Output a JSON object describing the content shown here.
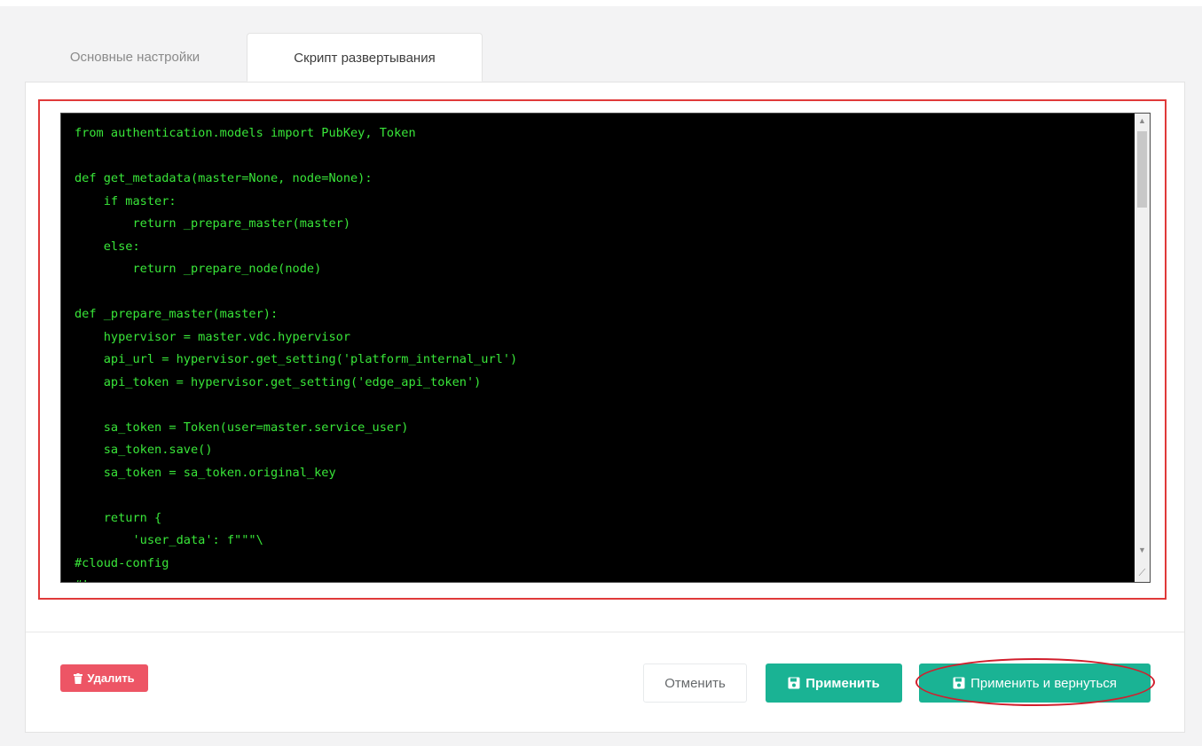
{
  "tabs": [
    {
      "label": "Основные настройки",
      "active": false
    },
    {
      "label": "Скрипт развертывания",
      "active": true
    }
  ],
  "editor": {
    "code": "from authentication.models import PubKey, Token\n\ndef get_metadata(master=None, node=None):\n    if master:\n        return _prepare_master(master)\n    else:\n        return _prepare_node(node)\n\ndef _prepare_master(master):\n    hypervisor = master.vdc.hypervisor\n    api_url = hypervisor.get_setting('platform_internal_url')\n    api_token = hypervisor.get_setting('edge_api_token')\n\n    sa_token = Token(user=master.service_user)\n    sa_token.save()\n    sa_token = sa_token.original_key\n\n    return {\n        'user_data': f\"\"\"\\\n#cloud-config\n#!"
  },
  "buttons": {
    "delete_label": "Удалить",
    "cancel_label": "Отменить",
    "apply_label": "Применить",
    "apply_return_label": "Применить и вернуться"
  },
  "colors": {
    "accent": "#1ab394",
    "danger": "#ed5565",
    "code_text": "#39e639",
    "code_bg": "#000000",
    "annotation": "#e03a3a"
  },
  "icons": {
    "delete": "trash-icon",
    "save": "floppy-disk-icon"
  }
}
